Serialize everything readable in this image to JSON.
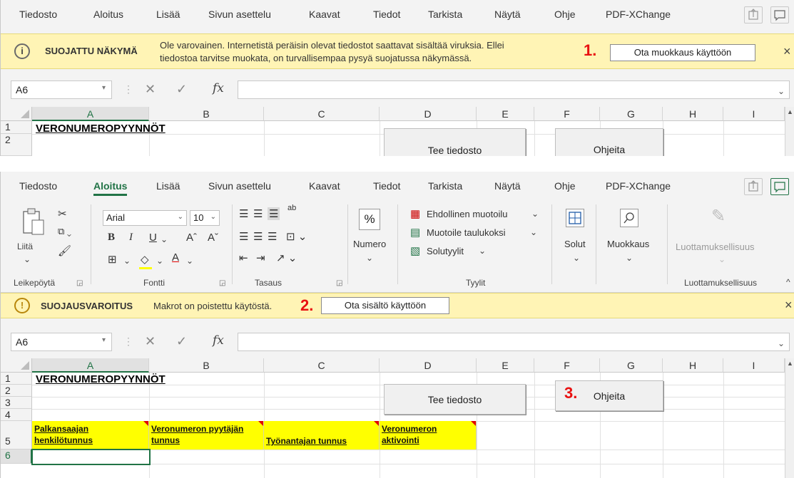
{
  "menu": {
    "tabs": [
      "Tiedosto",
      "Aloitus",
      "Lisää",
      "Sivun asettelu",
      "Kaavat",
      "Tiedot",
      "Tarkista",
      "Näytä",
      "Ohje",
      "PDF-XChange"
    ]
  },
  "protected_bar": {
    "title": "SUOJATTU NÄKYMÄ",
    "line1": "Ole varovainen. Internetistä peräisin olevat tiedostot saattavat sisältää viruksia. Ellei",
    "line2": "tiedostoa tarvitse muokata, on turvallisempaa pysyä suojatussa näkymässä.",
    "step": "1.",
    "button": "Ota muokkaus käyttöön",
    "close": "×"
  },
  "security_bar": {
    "title": "SUOJAUSVAROITUS",
    "text": "Makrot on poistettu käytöstä.",
    "step": "2.",
    "button": "Ota sisältö käyttöön",
    "close": "×"
  },
  "formula_bar": {
    "name_box": "A6",
    "fx": "fx"
  },
  "ribbon": {
    "clipboard": {
      "paste": "Liitä",
      "label": "Leikepöytä"
    },
    "font": {
      "name": "Arial",
      "size": "10",
      "bold": "B",
      "italic": "I",
      "underline": "U",
      "grow": "Aˆ",
      "shrink": "Aˇ",
      "label": "Fontti"
    },
    "alignment": {
      "label": "Tasaus",
      "wrap": "ab"
    },
    "number": {
      "symbol": "%",
      "label": "Numero"
    },
    "styles": {
      "conditional": "Ehdollinen muotoilu",
      "as_table": "Muotoile taulukoksi",
      "cell_styles": "Solutyylit",
      "label": "Tyylit"
    },
    "cells": {
      "label": "Solut"
    },
    "editing": {
      "label": "Muokkaus"
    },
    "sensitivity": {
      "button": "Luottamuksellisuus",
      "label": "Luottamuksellisuus"
    }
  },
  "sheet": {
    "columns": [
      "A",
      "B",
      "C",
      "D",
      "E",
      "F",
      "G",
      "H",
      "I"
    ],
    "title": "VERONUMEROPYYNNÖT",
    "btn_create": "Tee tiedosto",
    "btn_help": "Ohjeita",
    "step3": "3.",
    "headers": [
      "Palkansaajan henkilötunnus",
      "Veronumeron pyytäjän tunnus",
      "Työnantajan tunnus",
      "Veronumeron aktivointi"
    ],
    "rows1": [
      "1",
      "2"
    ],
    "rows2": [
      "1",
      "2",
      "3",
      "4",
      "5",
      "6"
    ]
  },
  "colors": {
    "excel_green": "#217346",
    "message_bar": "#fff4b5",
    "header_yellow": "#ffff00",
    "step_red": "#e81010"
  }
}
